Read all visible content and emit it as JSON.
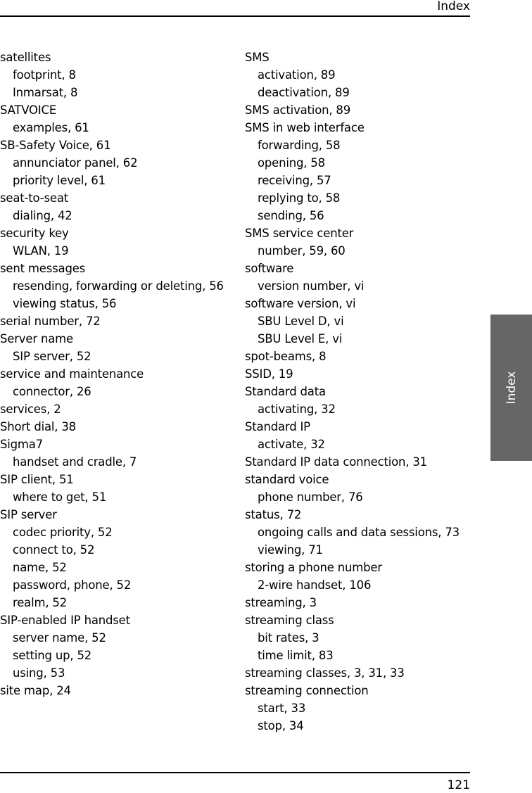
{
  "header": {
    "running_title": "Index"
  },
  "footer": {
    "page_number": "121"
  },
  "thumb_tab": {
    "label": "Index",
    "color": "#666666"
  },
  "columns": {
    "left": [
      {
        "text": "satellites",
        "level": 0
      },
      {
        "text": "footprint, 8",
        "level": 1
      },
      {
        "text": "Inmarsat, 8",
        "level": 1
      },
      {
        "text": "SATVOICE",
        "level": 0
      },
      {
        "text": "examples, 61",
        "level": 1
      },
      {
        "text": "SB-Safety Voice, 61",
        "level": 0
      },
      {
        "text": "annunciator panel, 62",
        "level": 1
      },
      {
        "text": "priority level, 61",
        "level": 1
      },
      {
        "text": "seat-to-seat",
        "level": 0
      },
      {
        "text": "dialing, 42",
        "level": 1
      },
      {
        "text": "security key",
        "level": 0
      },
      {
        "text": "WLAN, 19",
        "level": 1
      },
      {
        "text": "sent messages",
        "level": 0
      },
      {
        "text": "resending, forwarding or deleting, 56",
        "level": 1
      },
      {
        "text": "viewing status, 56",
        "level": 1
      },
      {
        "text": "serial number, 72",
        "level": 0
      },
      {
        "text": "Server name",
        "level": 0
      },
      {
        "text": "SIP server, 52",
        "level": 1
      },
      {
        "text": "service and maintenance",
        "level": 0
      },
      {
        "text": "connector, 26",
        "level": 1
      },
      {
        "text": "services, 2",
        "level": 0
      },
      {
        "text": "Short dial, 38",
        "level": 0
      },
      {
        "text": "Sigma7",
        "level": 0
      },
      {
        "text": "handset and cradle, 7",
        "level": 1
      },
      {
        "text": "SIP client, 51",
        "level": 0
      },
      {
        "text": "where to get, 51",
        "level": 1
      },
      {
        "text": "SIP server",
        "level": 0
      },
      {
        "text": "codec priority, 52",
        "level": 1
      },
      {
        "text": "connect to, 52",
        "level": 1
      },
      {
        "text": "name, 52",
        "level": 1
      },
      {
        "text": "password, phone, 52",
        "level": 1
      },
      {
        "text": "realm, 52",
        "level": 1
      },
      {
        "text": "SIP-enabled IP handset",
        "level": 0
      },
      {
        "text": "server name, 52",
        "level": 1
      },
      {
        "text": "setting up, 52",
        "level": 1
      },
      {
        "text": "using, 53",
        "level": 1
      },
      {
        "text": "site map, 24",
        "level": 0
      }
    ],
    "right": [
      {
        "text": "SMS",
        "level": 0
      },
      {
        "text": "activation, 89",
        "level": 1
      },
      {
        "text": "deactivation, 89",
        "level": 1
      },
      {
        "text": "SMS activation, 89",
        "level": 0
      },
      {
        "text": "SMS in web interface",
        "level": 0
      },
      {
        "text": "forwarding, 58",
        "level": 1
      },
      {
        "text": "opening, 58",
        "level": 1
      },
      {
        "text": "receiving, 57",
        "level": 1
      },
      {
        "text": "replying to, 58",
        "level": 1
      },
      {
        "text": "sending, 56",
        "level": 1
      },
      {
        "text": "SMS service center",
        "level": 0
      },
      {
        "text": "number, 59, 60",
        "level": 1
      },
      {
        "text": "software",
        "level": 0
      },
      {
        "text": "version number, vi",
        "level": 1
      },
      {
        "text": "software version, vi",
        "level": 0
      },
      {
        "text": "SBU Level D, vi",
        "level": 1
      },
      {
        "text": "SBU Level E, vi",
        "level": 1
      },
      {
        "text": "spot-beams, 8",
        "level": 0
      },
      {
        "text": "SSID, 19",
        "level": 0
      },
      {
        "text": "Standard data",
        "level": 0
      },
      {
        "text": "activating, 32",
        "level": 1
      },
      {
        "text": "Standard IP",
        "level": 0
      },
      {
        "text": "activate, 32",
        "level": 1
      },
      {
        "text": "Standard IP data connection, 31",
        "level": 0
      },
      {
        "text": "standard voice",
        "level": 0
      },
      {
        "text": "phone number, 76",
        "level": 1
      },
      {
        "text": "status, 72",
        "level": 0
      },
      {
        "text": "ongoing calls and data sessions, 73",
        "level": 1
      },
      {
        "text": "viewing, 71",
        "level": 1
      },
      {
        "text": "storing a phone number",
        "level": 0
      },
      {
        "text": "2-wire handset, 106",
        "level": 1
      },
      {
        "text": "streaming, 3",
        "level": 0
      },
      {
        "text": "streaming class",
        "level": 0
      },
      {
        "text": "bit rates, 3",
        "level": 1
      },
      {
        "text": "time limit, 83",
        "level": 1
      },
      {
        "text": "streaming classes, 3, 31, 33",
        "level": 0
      },
      {
        "text": "streaming connection",
        "level": 0
      },
      {
        "text": "start, 33",
        "level": 1
      },
      {
        "text": "stop, 34",
        "level": 1
      }
    ]
  }
}
